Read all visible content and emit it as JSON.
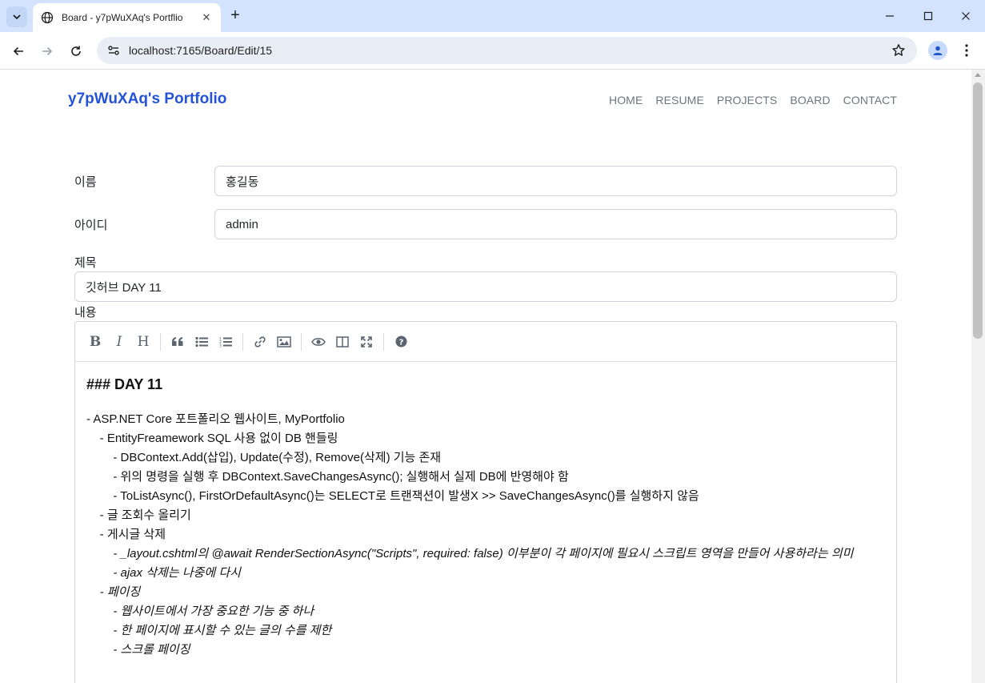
{
  "browser": {
    "tab_title": "Board - y7pWuXAq's Portflio",
    "url": "localhost:7165/Board/Edit/15"
  },
  "site": {
    "brand": "y7pWuXAq's Portfolio",
    "nav": [
      "HOME",
      "RESUME",
      "PROJECTS",
      "BOARD",
      "CONTACT"
    ]
  },
  "form": {
    "name_label": "이름",
    "name_value": "홍길동",
    "id_label": "아이디",
    "id_value": "admin",
    "title_label": "제목",
    "title_value": "깃허브 DAY 11",
    "content_label": "내용"
  },
  "editor": {
    "toolbar": [
      "bold",
      "italic",
      "heading",
      "quote",
      "unordered-list",
      "ordered-list",
      "link",
      "image",
      "preview",
      "side-by-side",
      "fullscreen",
      "guide"
    ],
    "heading": "### DAY 11",
    "lines": [
      {
        "text": "- ASP.NET Core 포트폴리오 웹사이트, MyPortfolio",
        "italic": false
      },
      {
        "text": "    - EntityFreamework SQL 사용 없이 DB 핸들링",
        "italic": false
      },
      {
        "text": "        - DBContext.Add(삽입), Update(수정), Remove(삭제) 기능 존재",
        "italic": false
      },
      {
        "text": "        - 위의 명령을 실행 후 DBContext.SaveChangesAsync(); 실행해서 실제 DB에 반영해야 함",
        "italic": false
      },
      {
        "text": "        - ToListAsync(), FirstOrDefaultAsync()는 SELECT로 트랜잭션이 발생X >> SaveChangesAsync()를 실행하지 않음",
        "italic": false
      },
      {
        "text": "    - 글 조회수 올리기",
        "italic": false
      },
      {
        "text": "    - 게시글 삭제",
        "italic": false
      },
      {
        "text": "        - _layout.cshtml의 @await RenderSectionAsync(\"Scripts\", required: false) 이부분이 각 페이지에 필요시 스크립트 영역을 만들어 사용하라는 의미",
        "italic": true
      },
      {
        "text": "        - ajax 삭제는 나중에 다시",
        "italic": true
      },
      {
        "text": "    - 페이징",
        "italic": true
      },
      {
        "text": "        - 웹사이트에서 가장 중요한 기능 중 하나",
        "italic": true
      },
      {
        "text": "        - 한 페이지에 표시할 수 있는 글의 수를 제한",
        "italic": true
      },
      {
        "text": "        - 스크롤 페이징",
        "italic": true
      }
    ]
  }
}
